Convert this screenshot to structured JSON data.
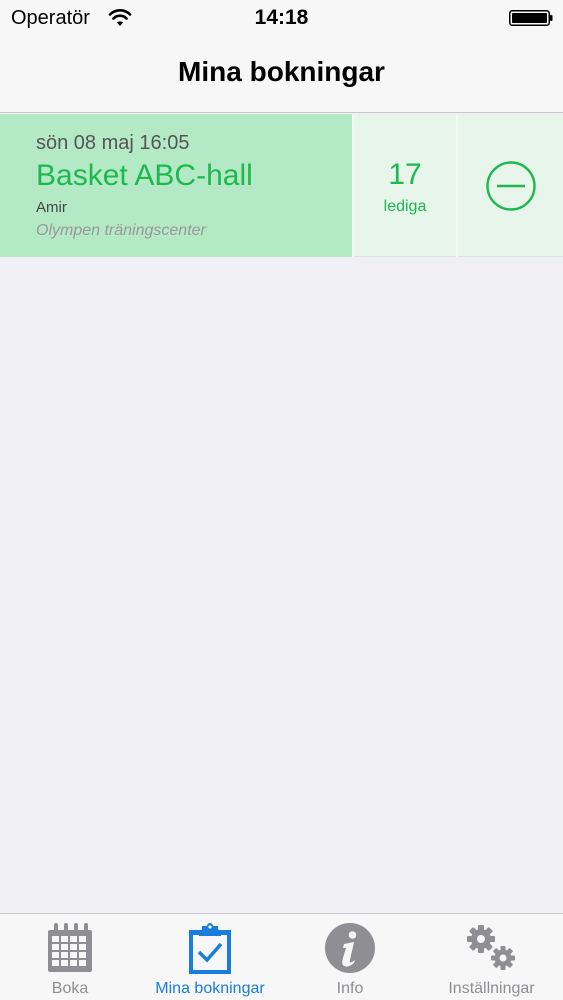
{
  "status_bar": {
    "carrier": "Operatör",
    "time": "14:18",
    "wifi_icon": "wifi-icon",
    "battery_icon": "battery-icon",
    "battery_level": 1.0
  },
  "nav": {
    "title": "Mina bokningar"
  },
  "bookings": [
    {
      "datetime": "sön 08 maj 16:05",
      "activity": "Basket ABC-hall",
      "person": "Amir",
      "center": "Olympen träningscenter",
      "spots_count": "17",
      "spots_label": "lediga",
      "action_icon": "cancel-booking-icon"
    }
  ],
  "tabbar": {
    "tabs": [
      {
        "label": "Boka",
        "icon": "calendar-icon",
        "active": false
      },
      {
        "label": "Mina bokningar",
        "icon": "clipboard-check-icon",
        "active": true
      },
      {
        "label": "Info",
        "icon": "info-icon",
        "active": false
      },
      {
        "label": "Inställningar",
        "icon": "gears-icon",
        "active": false
      }
    ]
  },
  "colors": {
    "accent_green": "#1db84e",
    "booking_bg": "#b4e9c5",
    "active_tab": "#1a7ddb",
    "inactive_tab": "#8e8e93",
    "background": "#efeff4"
  }
}
